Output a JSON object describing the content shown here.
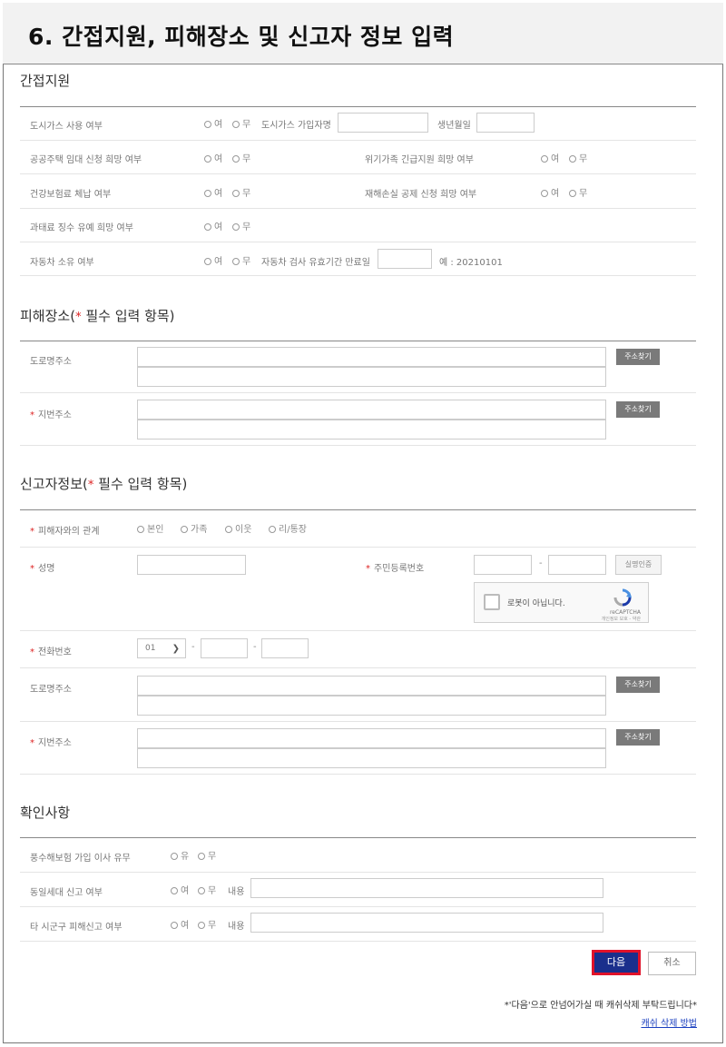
{
  "page_title": "6. 간접지원, 피해장소 및 신고자 정보 입력",
  "radio_labels": {
    "yes": "여",
    "no": "무",
    "yu": "유"
  },
  "indirect": {
    "title": "간접지원",
    "city_gas_label": "도시가스 사용 여부",
    "city_gas_subscriber_label": "도시가스 가입자명",
    "birthdate_label": "생년월일",
    "public_housing_label": "공공주택 임대 신청 희망 여부",
    "crisis_support_label": "위기가족 긴급지원 희망 여부",
    "health_insurance_label": "건강보험료 체납 여부",
    "disaster_deduction_label": "재해손실 공제 신청 희망 여부",
    "fine_label": "과태료 징수 유예 희망 여부",
    "car_label": "자동차 소유 여부",
    "car_inspection_label": "자동차 검사 유효기간 만료일",
    "car_inspection_example": "예 : 20210101"
  },
  "damage_place": {
    "title": "피해장소(",
    "required_note": "필수 입력 항목)",
    "road_label": "도로명주소",
    "lot_label": "지번주소",
    "search_button": "주소찾기"
  },
  "reporter": {
    "title": "신고자정보(",
    "required_note": "필수 입력 항목)",
    "relation_label": "피해자와의 관계",
    "relation_options": [
      "본인",
      "가족",
      "이웃",
      "리/통장"
    ],
    "name_label": "성명",
    "rrn_label": "주민등록번호",
    "rrn_separator": "-",
    "verify_button": "실명인증",
    "captcha_text": "로봇이 아닙니다.",
    "captcha_brand": "reCAPTCHA",
    "captcha_terms": "개인정보 보호 - 약관",
    "phone_label": "전화번호",
    "phone_prefix": "01",
    "phone_separator": "-",
    "road_label": "도로명주소",
    "lot_label": "지번주소",
    "search_button": "주소찾기"
  },
  "confirm": {
    "title": "확인사항",
    "flood_label": "풍수해보험 가입 이사 유무",
    "same_household_label": "동일세대 신고 여부",
    "other_region_label": "타 시군구 피해신고 여부",
    "content_label": "내용"
  },
  "actions": {
    "next": "다음",
    "cancel": "취소"
  },
  "notice": "*'다음'으로 안넘어가실 때 캐쉬삭제 부탁드립니다*",
  "cache_link": "캐쉬 삭제 방법",
  "colors": {
    "next_button": "#1a2f8c",
    "next_border": "#e0122a",
    "required_star": "#d22222",
    "link": "#1a3fbf"
  }
}
